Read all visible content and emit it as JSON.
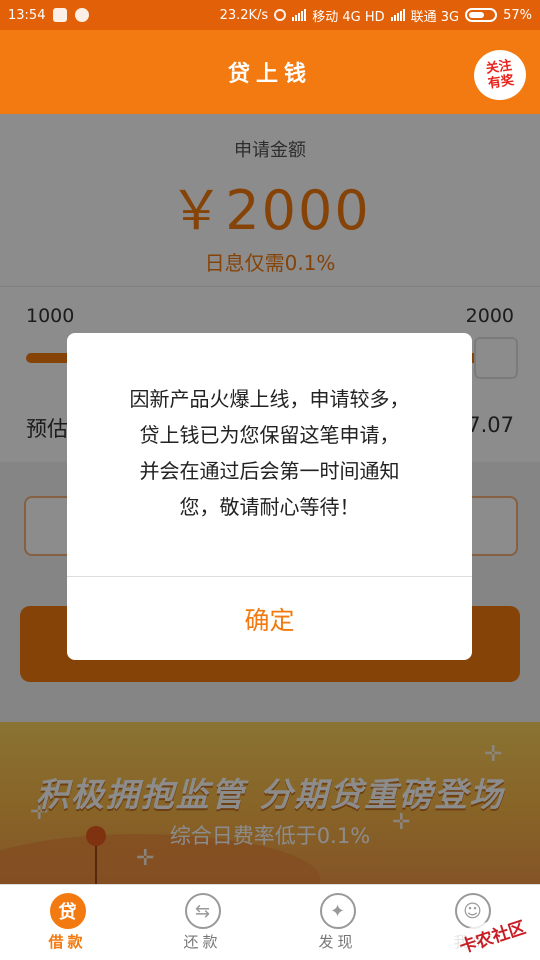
{
  "status_bar": {
    "time": "13:54",
    "network_speed": "23.2K/s",
    "carrier_1": "移动 4G HD",
    "carrier_2": "联通 3G",
    "battery": "57%"
  },
  "header": {
    "title": "贷上钱",
    "badge_line1": "关注",
    "badge_line2": "有奖"
  },
  "loan": {
    "amount_label": "申请金额",
    "amount": "￥2000",
    "rate_text": "日息仅需0.1%",
    "slider_min": "1000",
    "slider_max": "2000",
    "slider_level": 1.0,
    "estimate_label": "预估",
    "estimate_value": "7.07"
  },
  "banner": {
    "headline": "积极拥抱监管 分期贷重磅登场",
    "subline": "综合日费率低于0.1%"
  },
  "dialog": {
    "message_lines": [
      "因新产品火爆上线，申请较多，",
      "贷上钱已为您保留这笔申请，",
      "并会在通过后会第一时间通知",
      "您，敬请耐心等待！"
    ],
    "confirm_label": "确定"
  },
  "tabs": [
    {
      "label": "借款",
      "icon": "贷",
      "icon_name": "loan-icon",
      "active": true
    },
    {
      "label": "还款",
      "icon": "⇆",
      "icon_name": "repay-icon",
      "active": false
    },
    {
      "label": "发现",
      "icon": "✦",
      "icon_name": "compass-icon",
      "active": false
    },
    {
      "label": "我的",
      "icon": "☺",
      "icon_name": "profile-icon",
      "active": false
    }
  ],
  "watermark": "卡农社区",
  "colors": {
    "accent": "#f27a10",
    "status_bar": "#e26108",
    "overlay": "rgba(0,0,0,0.45)"
  }
}
